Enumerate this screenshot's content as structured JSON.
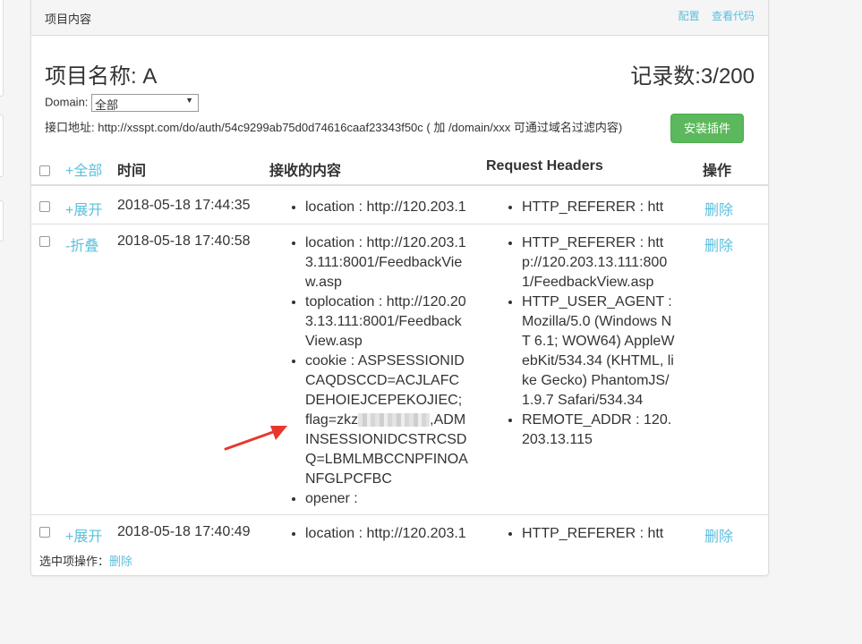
{
  "panel": {
    "title": "项目内容",
    "links": {
      "config": "配置",
      "view_code": "查看代码"
    }
  },
  "project": {
    "name": "项目名称: A",
    "record_count": "记录数:3/200"
  },
  "domain": {
    "label": "Domain:",
    "selected": "全部",
    "arrow": "▼"
  },
  "api": {
    "text": "接口地址: http://xsspt.com/do/auth/54c9299ab75d0d74616caaf23343f50c ( 加 /domain/xxx 可通过域名过滤内容)"
  },
  "install_button": "安装插件",
  "table": {
    "headers": {
      "toggle_all": "+全部",
      "time": "时间",
      "content": "接收的内容",
      "headers": "Request Headers",
      "action": "操作"
    },
    "rows": [
      {
        "toggle": "+展开",
        "time": "2018-05-18 17:44:35",
        "content": [
          "location : http://120.203.1"
        ],
        "headers": [
          "HTTP_REFERER : htt"
        ],
        "delete": "删除"
      },
      {
        "toggle": "-折叠",
        "time": "2018-05-18 17:40:58",
        "content": [
          "location : http://120.203.13.111:8001/FeedbackView.asp",
          "toplocation : http://120.203.13.111:8001/FeedbackView.asp",
          "opener :"
        ],
        "cookie_prefix": "cookie : ASPSESSIONIDCAQDSCCD=ACJLAFCDEHOIEJCEPEKOJIEC; flag=zkz",
        "cookie_suffix": ",ADMINSESSIONIDCSTRCSDQ=LBMLMBCCNPFINOANFGLPCFBC",
        "headers": [
          "HTTP_REFERER : http://120.203.13.111:8001/FeedbackView.asp",
          "HTTP_USER_AGENT : Mozilla/5.0 (Windows NT 6.1; WOW64) AppleWebKit/534.34 (KHTML, like Gecko) PhantomJS/1.9.7 Safari/534.34",
          "REMOTE_ADDR : 120.203.13.115"
        ],
        "delete": "删除"
      },
      {
        "toggle": "+展开",
        "time": "2018-05-18 17:40:49",
        "content": [
          "location : http://120.203.1"
        ],
        "headers": [
          "HTTP_REFERER : htt"
        ],
        "delete": "删除"
      }
    ]
  },
  "footer": {
    "label": "选中项操作：",
    "delete": "删除"
  },
  "colors": {
    "accent": "#5bc0de",
    "install_green": "#5cb85c",
    "arrow_red": "#e8372c"
  }
}
